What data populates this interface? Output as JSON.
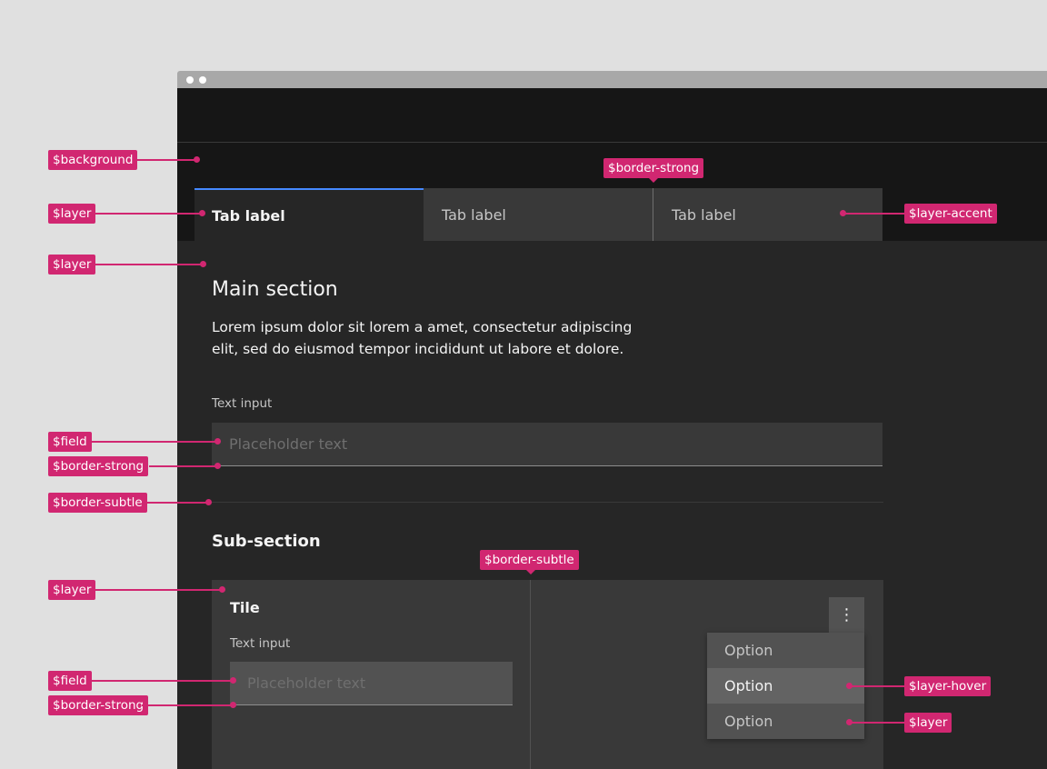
{
  "window": {
    "dots": [
      "window-dot-1",
      "window-dot-2"
    ]
  },
  "tabs": [
    {
      "label": "Tab label",
      "selected": true
    },
    {
      "label": "Tab label",
      "selected": false
    },
    {
      "label": "Tab label",
      "selected": false
    }
  ],
  "main": {
    "title": "Main section",
    "body": "Lorem ipsum dolor sit lorem a amet, consectetur adipiscing elit, sed do eiusmod tempor incididunt ut labore et dolore.",
    "input_label": "Text input",
    "input_placeholder": "Placeholder text",
    "sub_title": "Sub-section"
  },
  "tile": {
    "title": "Tile",
    "input_label": "Text input",
    "input_placeholder": "Placeholder text",
    "overflow_icon": "⋮",
    "menu_options": [
      "Option",
      "Option",
      "Option"
    ],
    "hovered_index": 1
  },
  "annotations": {
    "background": "$background",
    "layer_tab": "$layer",
    "layer_main": "$layer",
    "border_strong_tab": "$border-strong",
    "layer_accent": "$layer-accent",
    "field_main": "$field",
    "border_strong_main": "$border-strong",
    "border_subtle_main": "$border-subtle",
    "border_subtle_tile": "$border-subtle",
    "layer_tile": "$layer",
    "field_tile": "$field",
    "border_strong_tile": "$border-strong",
    "layer_hover": "$layer-hover",
    "layer_menu": "$layer"
  },
  "colors": {
    "annotation": "#d12771",
    "background": "#161616",
    "layer_01": "#262626",
    "layer_02": "#393939",
    "layer_03": "#525252",
    "layer_hover": "#636363",
    "tab_selected_indicator": "#4589ff",
    "border_strong": "#8d8d8d",
    "border_subtle": "#393939"
  }
}
